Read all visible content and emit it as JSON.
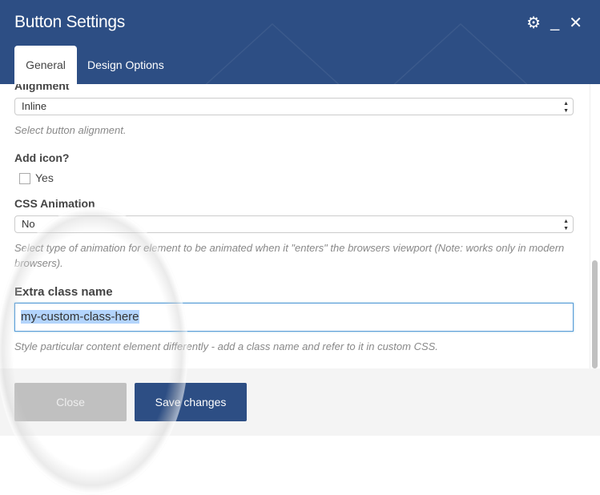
{
  "header": {
    "title": "Button Settings",
    "icons": [
      "gear-icon",
      "minimize-icon",
      "close-icon"
    ]
  },
  "tabs": [
    {
      "label": "General",
      "active": true
    },
    {
      "label": "Design Options",
      "active": false
    }
  ],
  "form": {
    "alignment": {
      "label": "Alignment",
      "value": "Inline",
      "help": "Select button alignment."
    },
    "add_icon": {
      "label": "Add icon?",
      "option": "Yes",
      "checked": false
    },
    "css_animation": {
      "label": "CSS Animation",
      "value": "No",
      "help": "Select type of animation for element to be animated when it \"enters\" the browsers viewport (Note: works only in modern browsers)."
    },
    "extra_class": {
      "label": "Extra class name",
      "value": "my-custom-class-here",
      "help": "Style particular content element differently - add a class name and refer to it in custom CSS."
    }
  },
  "footer": {
    "close": "Close",
    "save": "Save changes"
  },
  "colors": {
    "brand": "#2d4e84",
    "focus": "#5b9dd9",
    "selection": "#b3d4fc"
  }
}
